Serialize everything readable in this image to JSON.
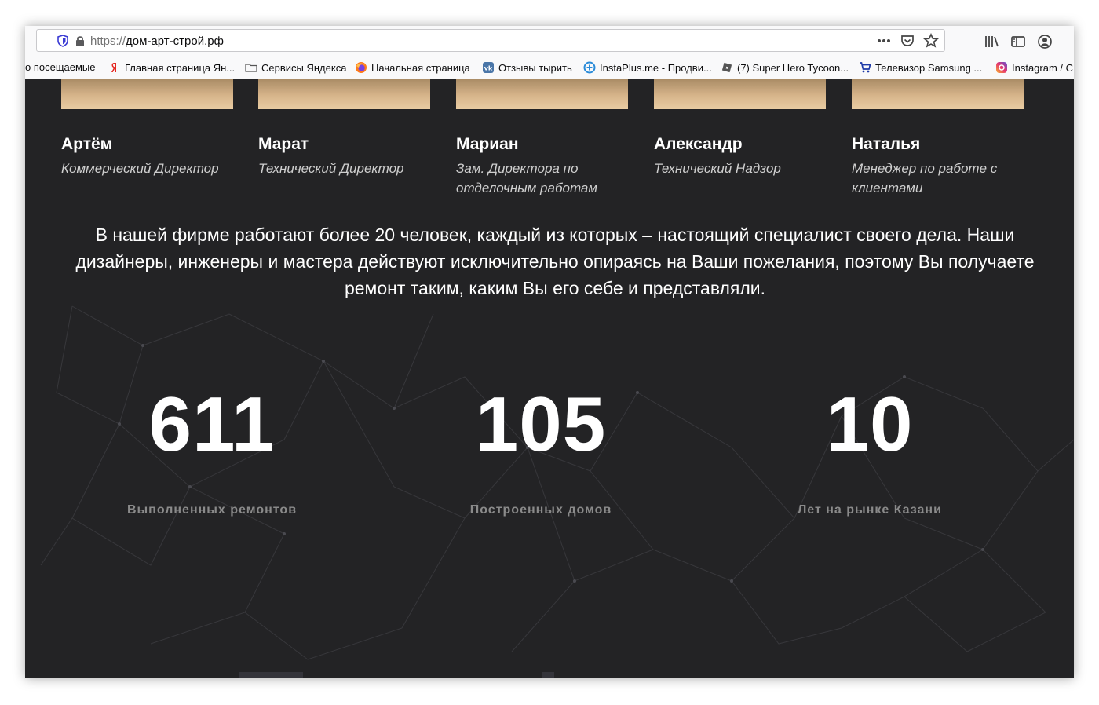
{
  "browser": {
    "url_protocol": "https://",
    "url_host": "дом-арт-строй.рф"
  },
  "bookmarks": [
    {
      "label": "о посещаемые",
      "icon": "none"
    },
    {
      "label": "Главная страница Ян...",
      "icon": "yandex-icon"
    },
    {
      "label": "Сервисы Яндекса",
      "icon": "folder-icon"
    },
    {
      "label": "Начальная страница",
      "icon": "firefox-icon"
    },
    {
      "label": "Отзывы тырить",
      "icon": "vk-icon"
    },
    {
      "label": "InstaPlus.me - Продви...",
      "icon": "instaplus-icon"
    },
    {
      "label": "(7) Super Hero Tycoon...",
      "icon": "roblox-icon"
    },
    {
      "label": "Телевизор Samsung ...",
      "icon": "cart-icon"
    },
    {
      "label": "Instagram / C",
      "icon": "instagram-icon"
    }
  ],
  "team": [
    {
      "name": "Артём",
      "role": "Коммерческий Директор"
    },
    {
      "name": "Марат",
      "role": "Технический Директор"
    },
    {
      "name": "Мариан",
      "role": "Зам. Директора по отделочным работам"
    },
    {
      "name": "Александр",
      "role": "Технический Надзор"
    },
    {
      "name": "Наталья",
      "role": "Менеджер по работе с клиентами"
    }
  ],
  "intro_text": "В нашей фирме работают более 20 человек, каждый из которых – настоящий специалист своего дела. Наши дизайнеры, инженеры и мастера действуют исключительно опираясь на Ваши пожелания, поэтому Вы получаете ремонт таким, каким Вы его себе и представляли.",
  "stats": [
    {
      "value": "611",
      "label": "Выполненных ремонтов"
    },
    {
      "value": "105",
      "label": "Построенных домов"
    },
    {
      "value": "10",
      "label": "Лет на рынке Казани"
    }
  ]
}
